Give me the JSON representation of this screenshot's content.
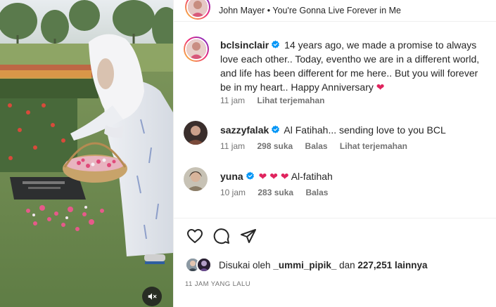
{
  "post": {
    "music_user_avatar": "bclsinclair-avatar",
    "music_label": "John Mayer • You're Gonna Live Forever in Me"
  },
  "caption": {
    "username": "bclsinclair",
    "verified": true,
    "text": "14 years ago, we made a promise to always love each other.. Today, eventho we are in a different world, and life has been different for me here.. But you will forever be in my heart.. Happy Anniversary",
    "emoji": "❤️",
    "time": "11 jam",
    "see_translation": "Lihat terjemahan"
  },
  "comments": [
    {
      "username": "sazzyfalak",
      "verified": true,
      "text": "Al Fatihah... sending love to you BCL",
      "time": "11 jam",
      "likes": "298 suka",
      "reply": "Balas",
      "see_translation": "Lihat terjemahan"
    },
    {
      "username": "yuna",
      "verified": true,
      "hearts": "❤ ❤ ❤",
      "text": "Al-fatihah",
      "time": "10 jam",
      "likes": "283 suka",
      "reply": "Balas"
    }
  ],
  "actions": {
    "like_icon": "heart-icon",
    "comment_icon": "comment-icon",
    "share_icon": "send-icon"
  },
  "likes": {
    "prefix": "Disukai oleh",
    "user": "_ummi_pipik_",
    "connector": "dan",
    "others": "227,251 lainnya"
  },
  "timestamp": "11 JAM YANG LALU",
  "colors": {
    "verified": "#0095f6",
    "heart": "#ed4956",
    "muted_text": "#737373"
  }
}
